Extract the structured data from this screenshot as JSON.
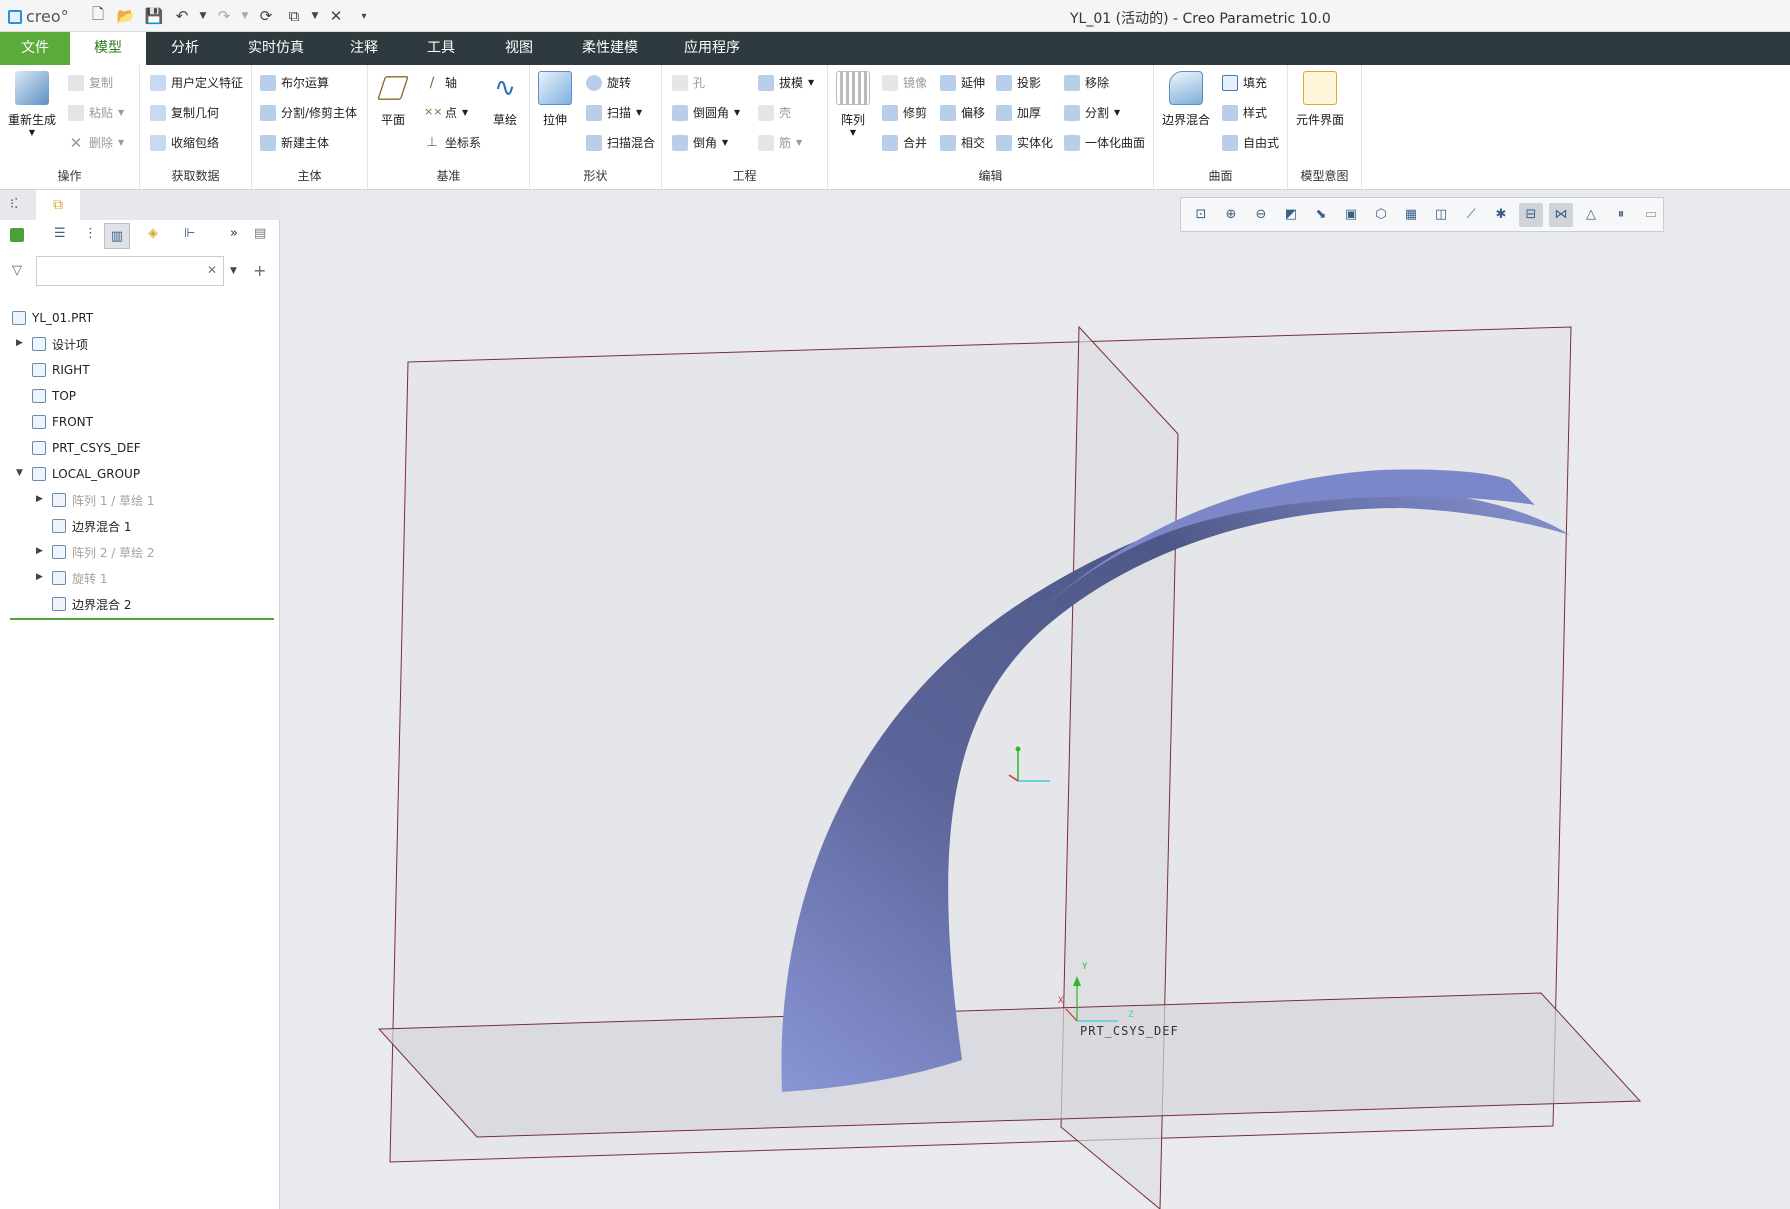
{
  "app": {
    "logo_text": "creo°",
    "window_title": "YL_01 (活动的) - Creo Parametric 10.0"
  },
  "tabs": [
    "文件",
    "模型",
    "分析",
    "实时仿真",
    "注释",
    "工具",
    "视图",
    "柔性建模",
    "应用程序"
  ],
  "active_tab": "模型",
  "ribbon": {
    "operations": {
      "regen": "重新生成",
      "copy": "复制",
      "paste": "粘贴",
      "delete": "删除",
      "label": "操作"
    },
    "getdata": {
      "udf": "用户定义特征",
      "copygeom": "复制几何",
      "shrinkwrap": "收缩包络",
      "label": "获取数据"
    },
    "body": {
      "boolean": "布尔运算",
      "split": "分割/修剪主体",
      "newbody": "新建主体",
      "label": "主体"
    },
    "datum": {
      "plane": "平面",
      "axis": "轴",
      "point": "点",
      "csys": "坐标系",
      "sketch": "草绘",
      "label": "基准"
    },
    "shapes": {
      "extrude": "拉伸",
      "revolve": "旋转",
      "sweep": "扫描",
      "swept_blend": "扫描混合",
      "label": "形状"
    },
    "engineering": {
      "hole": "孔",
      "round": "倒圆角",
      "chamfer": "倒角",
      "draft": "拔模",
      "shell": "壳",
      "rib": "筋",
      "label": "工程"
    },
    "editing": {
      "pattern": "阵列",
      "mirror": "镜像",
      "trim": "修剪",
      "merge": "合并",
      "extend": "延伸",
      "offset": "偏移",
      "intersect": "相交",
      "project": "投影",
      "thicken": "加厚",
      "solidify": "实体化",
      "remove": "移除",
      "split": "分割",
      "unify": "一体化曲面",
      "label": "编辑"
    },
    "surfaces": {
      "boundary": "边界混合",
      "fill": "填充",
      "style": "样式",
      "freestyle": "自由式",
      "label": "曲面"
    },
    "intent": {
      "component_interface": "元件界面",
      "label": "模型意图"
    }
  },
  "tree": [
    {
      "label": "YL_01.PRT",
      "level": 0,
      "dim": false
    },
    {
      "label": "设计项",
      "level": 1,
      "dim": false
    },
    {
      "label": "RIGHT",
      "level": 1,
      "dim": false
    },
    {
      "label": "TOP",
      "level": 1,
      "dim": false
    },
    {
      "label": "FRONT",
      "level": 1,
      "dim": false
    },
    {
      "label": "PRT_CSYS_DEF",
      "level": 1,
      "dim": false
    },
    {
      "label": "LOCAL_GROUP",
      "level": 1,
      "dim": false
    },
    {
      "label": "阵列 1 / 草绘 1",
      "level": 2,
      "dim": true
    },
    {
      "label": "边界混合 1",
      "level": 2,
      "dim": false
    },
    {
      "label": "阵列 2 / 草绘 2",
      "level": 2,
      "dim": true
    },
    {
      "label": "旋转 1",
      "level": 2,
      "dim": true
    },
    {
      "label": "边界混合 2",
      "level": 2,
      "dim": false
    }
  ],
  "viewport": {
    "csys_label": "PRT_CSYS_DEF",
    "axis_x": "X",
    "axis_y": "Y",
    "axis_z": "Z",
    "surface_color": "#6b76b4",
    "plane_edge_color": "#7a2c3a"
  },
  "view_toolbar_icons": [
    "refit",
    "zoom-in",
    "zoom-out",
    "repaint",
    "perspective",
    "display-style",
    "saved-orientations",
    "view-manager",
    "datum-display",
    "annotation-display",
    "spin-center",
    "planes-display",
    "axes-display",
    "points-display",
    "pause",
    "tools"
  ]
}
